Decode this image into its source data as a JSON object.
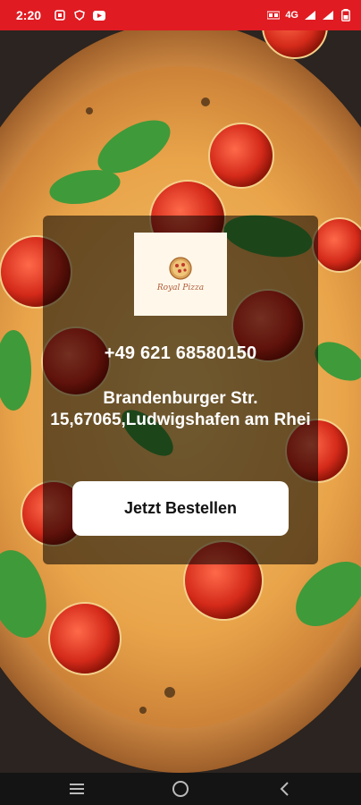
{
  "status_bar": {
    "time": "2:20",
    "network": "4G"
  },
  "card": {
    "logo_text": "Royal Pizza",
    "phone": "+49 621 68580150",
    "address": "Brandenburger Str. 15,67065,Ludwigshafen am Rhei",
    "order_button": "Jetzt Bestellen"
  },
  "colors": {
    "status_bar": "#e01b22",
    "card_overlay": "rgba(0,0,0,0.55)",
    "button_bg": "#ffffff"
  },
  "icons": {
    "status_left": [
      "notification-icon",
      "shield-icon",
      "youtube-icon"
    ],
    "status_right": [
      "volte-icon",
      "signal-icon",
      "battery-icon"
    ],
    "nav": [
      "recents-icon",
      "home-icon",
      "back-icon"
    ]
  }
}
